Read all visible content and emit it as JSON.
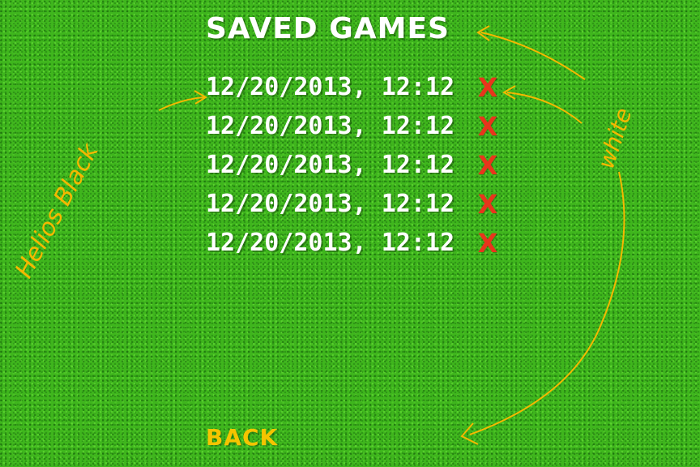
{
  "screen": {
    "title": "SAVED GAMES",
    "back_label": "BACK"
  },
  "saved_games": [
    {
      "label": "12/20/2013, 12:12",
      "delete_glyph": "X"
    },
    {
      "label": "12/20/2013, 12:12",
      "delete_glyph": "X"
    },
    {
      "label": "12/20/2013, 12:12",
      "delete_glyph": "X"
    },
    {
      "label": "12/20/2013, 12:12",
      "delete_glyph": "X"
    },
    {
      "label": "12/20/2013, 12:12",
      "delete_glyph": "X"
    }
  ],
  "annotations": {
    "left_note": "Helios Black",
    "right_note": "white"
  },
  "colors": {
    "background": "#3fb61d",
    "text": "#ffffff",
    "delete": "#e8351c",
    "back": "#f5c400",
    "annotation": "#f5b800"
  },
  "icons": {
    "delete": "close-icon"
  }
}
